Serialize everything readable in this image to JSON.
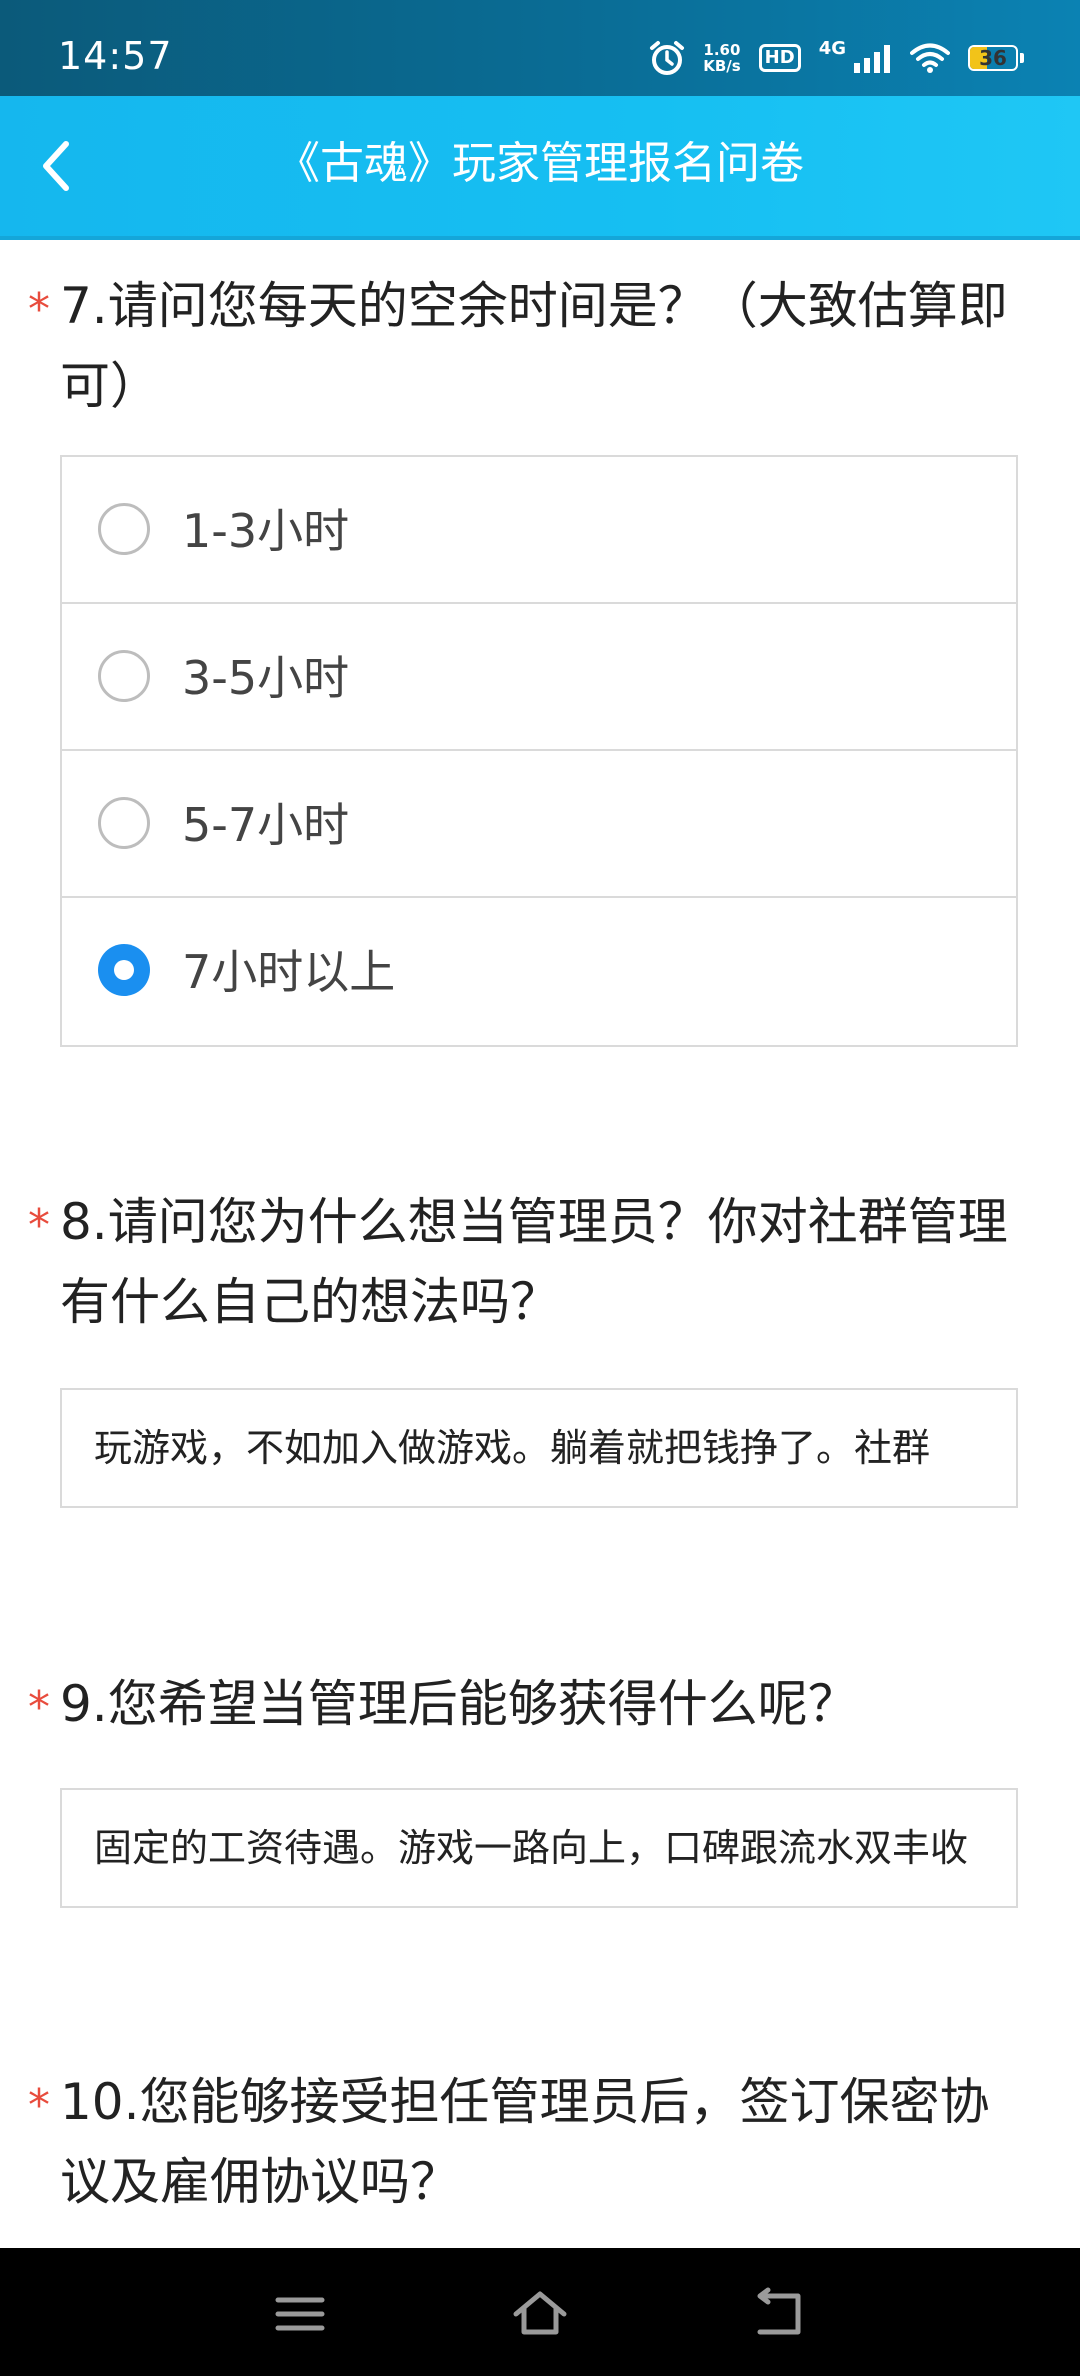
{
  "status_bar": {
    "time": "14:57",
    "net_speed_value": "1.60",
    "net_speed_unit": "KB/s",
    "hd_label": "HD",
    "network_type": "4G",
    "battery_level": "36",
    "battery_fraction": 0.36,
    "battery_color": "#f2c319",
    "icons": [
      "alarm-icon",
      "signal-icon",
      "wifi-icon",
      "battery-icon"
    ]
  },
  "app_bar": {
    "title": "《古魂》玩家管理报名问卷",
    "back_icon": "chevron-left-icon",
    "accent": "#16bff2"
  },
  "questions": [
    {
      "required_mark": "*",
      "text": "7.请问您每天的空余时间是？（大致估算即可）",
      "options": [
        {
          "label": "1-3小时",
          "selected": false
        },
        {
          "label": "3-5小时",
          "selected": false
        },
        {
          "label": "5-7小时",
          "selected": false
        },
        {
          "label": "7小时以上",
          "selected": true
        }
      ]
    },
    {
      "required_mark": "*",
      "text": "8.请问您为什么想当管理员？你对社群管理有什么自己的想法吗？",
      "answer": "玩游戏，不如加入做游戏。躺着就把钱挣了。社群"
    },
    {
      "required_mark": "*",
      "text": "9.您希望当管理后能够获得什么呢？",
      "answer": "固定的工资待遇。游戏一路向上，口碑跟流水双丰收"
    },
    {
      "required_mark": "*",
      "text": "10.您能够接受担任管理员后，签订保密协议及雇佣协议吗？"
    }
  ],
  "selected_color": "#1a8ff0",
  "required_color": "#e84c3d",
  "nav_bar": {
    "icons": [
      "menu-icon",
      "home-icon",
      "back-icon"
    ]
  }
}
